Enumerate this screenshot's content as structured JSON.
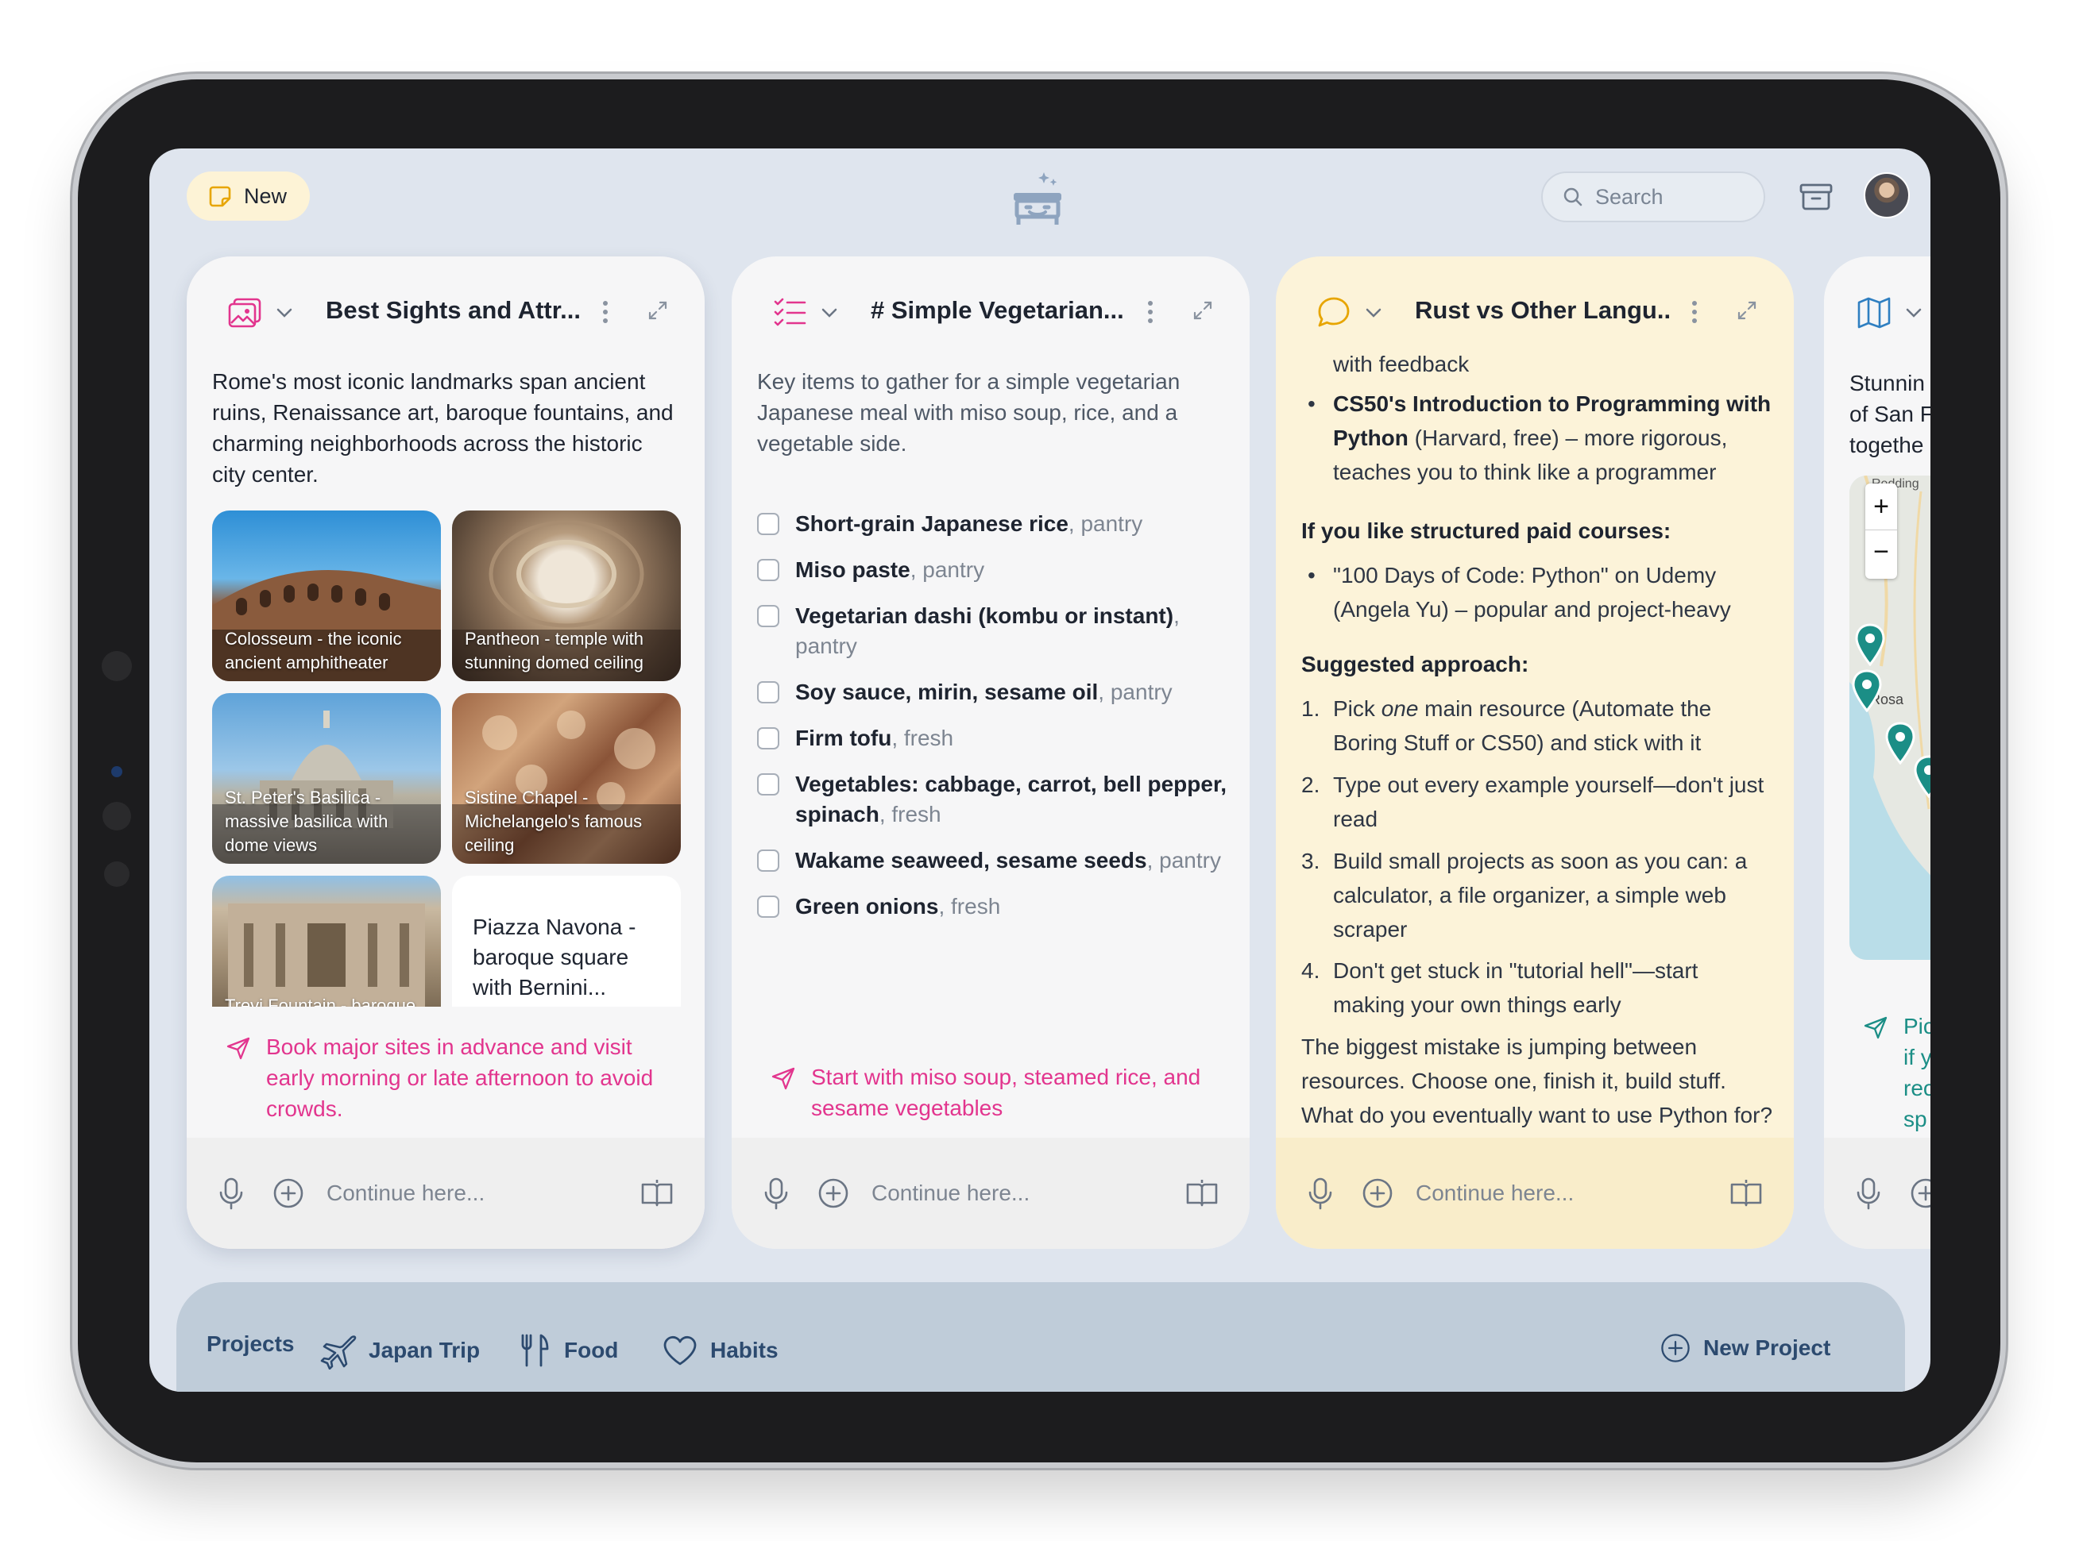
{
  "topbar": {
    "new_label": "New",
    "search_placeholder": "Search"
  },
  "cards": [
    {
      "type_icon": "image-gallery-icon",
      "title": "Best Sights and Attr...",
      "intro": "Rome's most iconic landmarks span ancient ruins, Renaissance art, baroque fountains, and charming neighborhoods across the historic city center.",
      "images": [
        {
          "caption": "Colosseum - the iconic ancient amphitheater"
        },
        {
          "caption": "Pantheon - temple with stunning domed ceiling"
        },
        {
          "caption": "St. Peter's Basilica - massive basilica with dome views"
        },
        {
          "caption": "Sistine Chapel - Michelangelo's famous ceiling"
        },
        {
          "caption": "Trevi Fountain - baroque"
        },
        {
          "caption": "Piazza Navona - baroque square with Bernini..."
        }
      ],
      "tip": "Book major sites in advance and visit early morning or late afternoon to avoid crowds.",
      "input_placeholder": "Continue here..."
    },
    {
      "type_icon": "checklist-icon",
      "title": "# Simple Vegetarian...",
      "intro": "Key items to gather for a simple vegetarian Japanese meal with miso soup, rice, and a vegetable side.",
      "items": [
        {
          "name": "Short-grain Japanese rice",
          "tag": ", pantry"
        },
        {
          "name": "Miso paste",
          "tag": ", pantry"
        },
        {
          "name": "Vegetarian dashi (kombu or instant)",
          "tag": ", pantry"
        },
        {
          "name": "Soy sauce, mirin, sesame oil",
          "tag": ", pantry"
        },
        {
          "name": "Firm tofu",
          "tag": ", fresh"
        },
        {
          "name": "Vegetables: cabbage, carrot, bell pepper, spinach",
          "tag": ", fresh"
        },
        {
          "name": "Wakame seaweed, sesame seeds",
          "tag": ", pantry"
        },
        {
          "name": "Green onions",
          "tag": ", fresh"
        }
      ],
      "tip": "Start with miso soup, steamed rice, and sesame vegetables",
      "input_placeholder": "Continue here..."
    },
    {
      "type_icon": "chat-bubble-icon",
      "title": "Rust vs Other Langu...",
      "content": {
        "line0": "with feedback",
        "bullet1_bold": "CS50's Introduction to Programming with Python",
        "bullet1_rest": " (Harvard, free) – more rigorous, teaches you to think like a programmer",
        "heading1": "If you like structured paid courses:",
        "bullet2": "\"100 Days of Code: Python\" on Udemy (Angela Yu) – popular and project-heavy",
        "heading2": "Suggested approach:",
        "step1_a": "Pick ",
        "step1_em": "one",
        "step1_b": " main resource (Automate the Boring Stuff or CS50) and stick with it",
        "step2": "Type out every example yourself—don't just read",
        "step3": "Build small projects as soon as you can: a calculator, a file organizer, a simple web scraper",
        "step4": "Don't get stuck in \"tutorial hell\"—start making your own things early",
        "closing": "The biggest mistake is jumping between resources. Choose one, finish it, build stuff. What do you eventually want to use Python for?"
      },
      "input_placeholder": "Continue here..."
    },
    {
      "type_icon": "map-icon",
      "intro_partial": [
        "Stunnin",
        "of San F",
        "togethe"
      ],
      "map_labels": [
        "Redding",
        "Rosa"
      ],
      "tip_partial": [
        "Pic",
        "if y",
        "rec",
        "sp"
      ]
    }
  ],
  "bottom_nav": {
    "projects_label": "Projects",
    "items": [
      {
        "icon": "airplane-icon",
        "label": "Japan Trip"
      },
      {
        "icon": "fork-knife-icon",
        "label": "Food"
      },
      {
        "icon": "heart-icon",
        "label": "Habits"
      }
    ],
    "new_project_label": "New Project"
  },
  "colors": {
    "accent_pink": "#e2358e",
    "nav_blue": "#2c4a6f",
    "yellow_card": "#fcf3d9",
    "map_teal": "#1b8e86"
  }
}
